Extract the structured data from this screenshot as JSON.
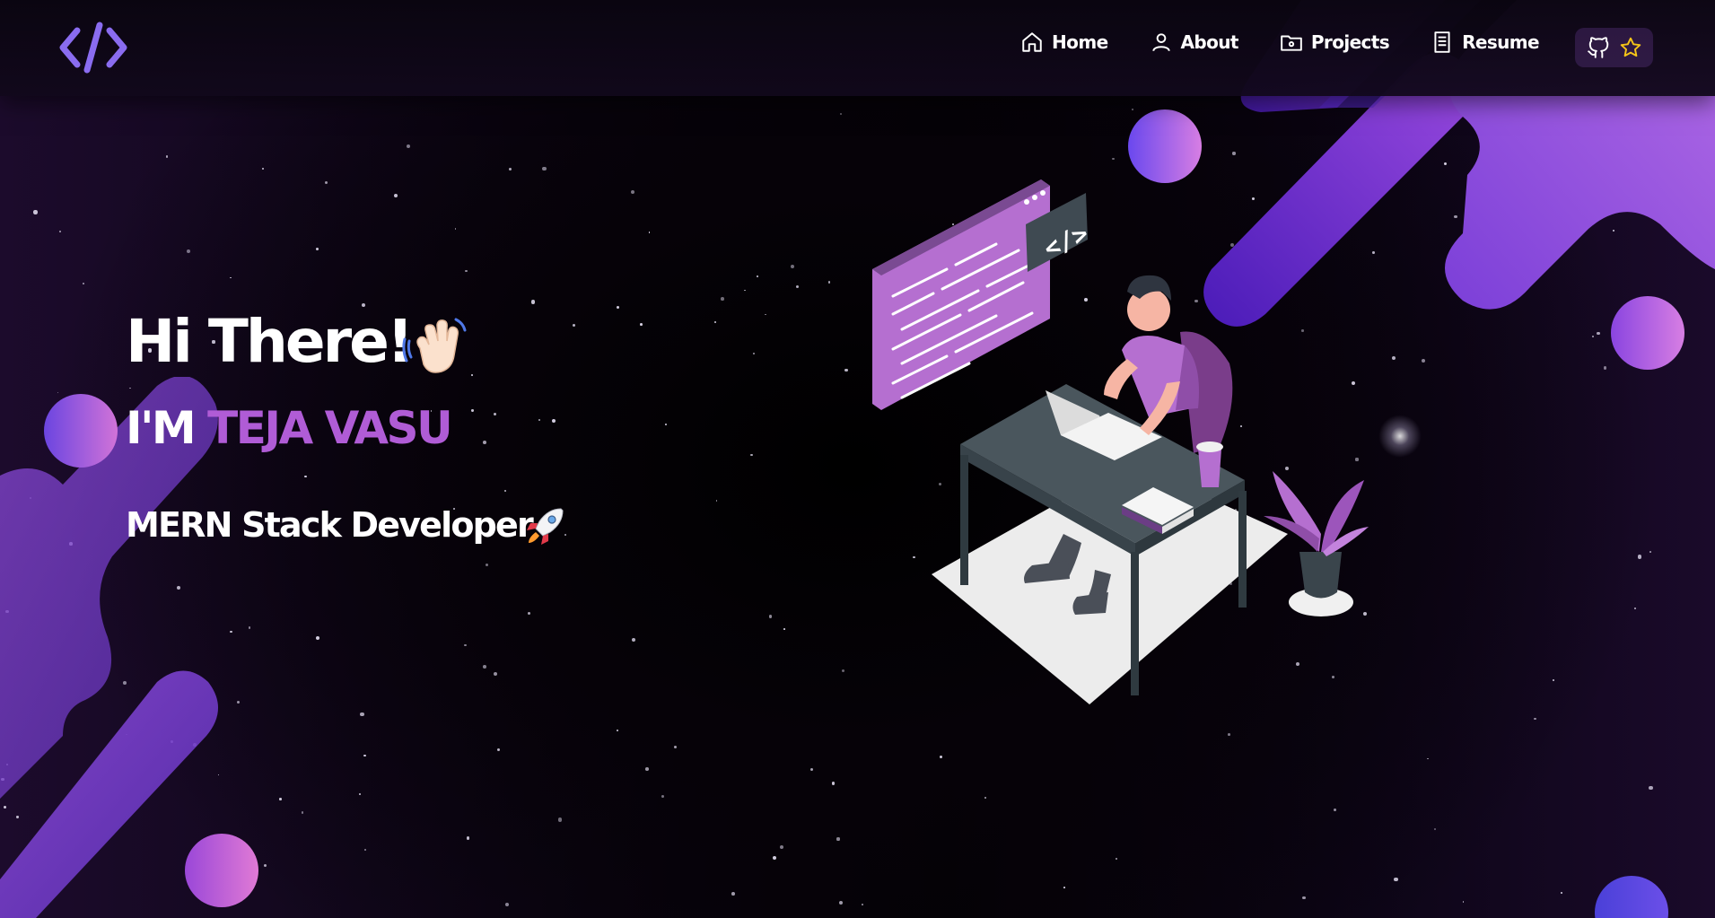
{
  "navbar": {
    "logo_icon": "code-brackets-icon",
    "items": [
      {
        "label": "Home",
        "icon": "home-icon"
      },
      {
        "label": "About",
        "icon": "user-icon"
      },
      {
        "label": "Projects",
        "icon": "folder-icon"
      },
      {
        "label": "Resume",
        "icon": "document-icon"
      }
    ],
    "github_button": {
      "icons": [
        "github-icon",
        "star-icon"
      ]
    }
  },
  "hero": {
    "greeting": "Hi There!",
    "greeting_emoji": "waving-hand",
    "im_prefix": "I'M",
    "name": "TEJA VASU",
    "role": "MERN Stack Developer",
    "role_emoji": "rocket"
  },
  "colors": {
    "accent": "#b05cd6",
    "logo": "#8a6cf0",
    "blob_purple": "#7a3fd0",
    "blob_pink": "#c46ee0",
    "background": "#050208"
  }
}
